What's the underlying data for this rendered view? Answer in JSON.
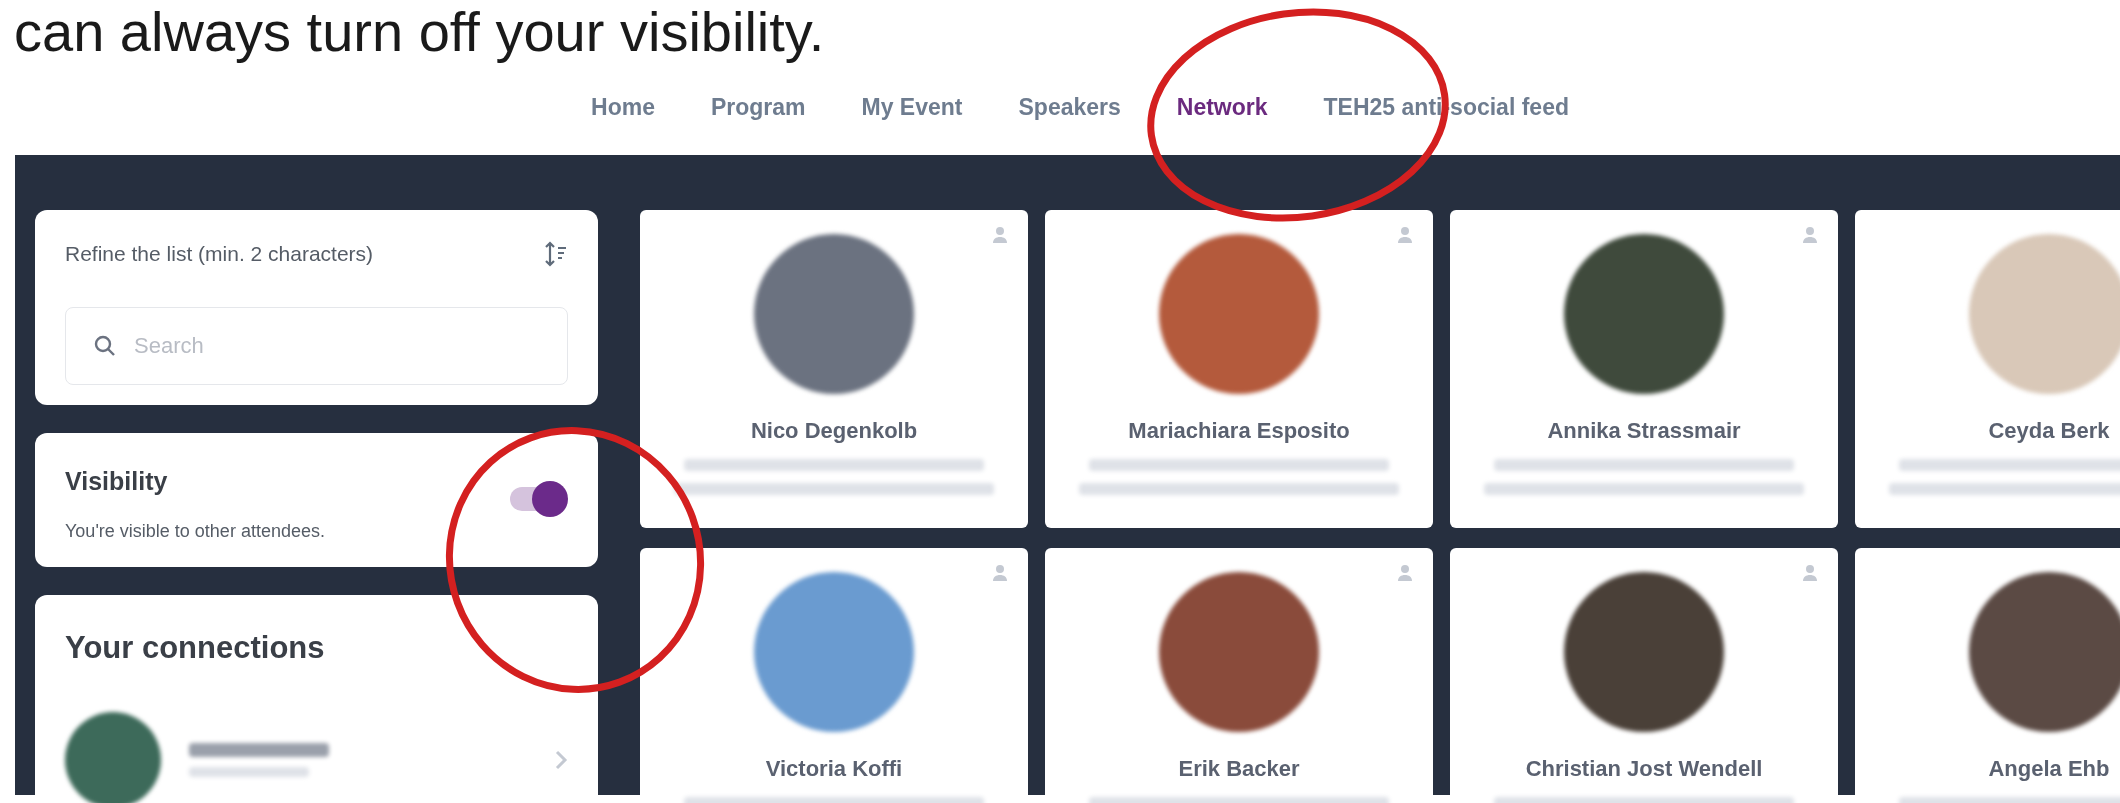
{
  "caption": "can always turn off your visibility.",
  "nav": [
    {
      "label": "Home",
      "selected": false
    },
    {
      "label": "Program",
      "selected": false
    },
    {
      "label": "My Event",
      "selected": false
    },
    {
      "label": "Speakers",
      "selected": false
    },
    {
      "label": "Network",
      "selected": true
    },
    {
      "label": "TEH25 anti-social feed",
      "selected": false
    }
  ],
  "filter": {
    "label": "Refine the list (min. 2 characters)",
    "search": {
      "placeholder": "Search"
    }
  },
  "visibility": {
    "title": "Visibility",
    "description": "You're visible to other attendees.",
    "on": true
  },
  "connections": {
    "title": "Your connections"
  },
  "attendees": [
    {
      "name": "Nico Degenkolb"
    },
    {
      "name": "Mariachiara Esposito"
    },
    {
      "name": "Annika Strassmair"
    },
    {
      "name": "Ceyda Berk"
    },
    {
      "name": "Victoria Koffi"
    },
    {
      "name": "Erik Backer"
    },
    {
      "name": "Christian Jost Wendell"
    },
    {
      "name": "Angela Ehb"
    }
  ]
}
